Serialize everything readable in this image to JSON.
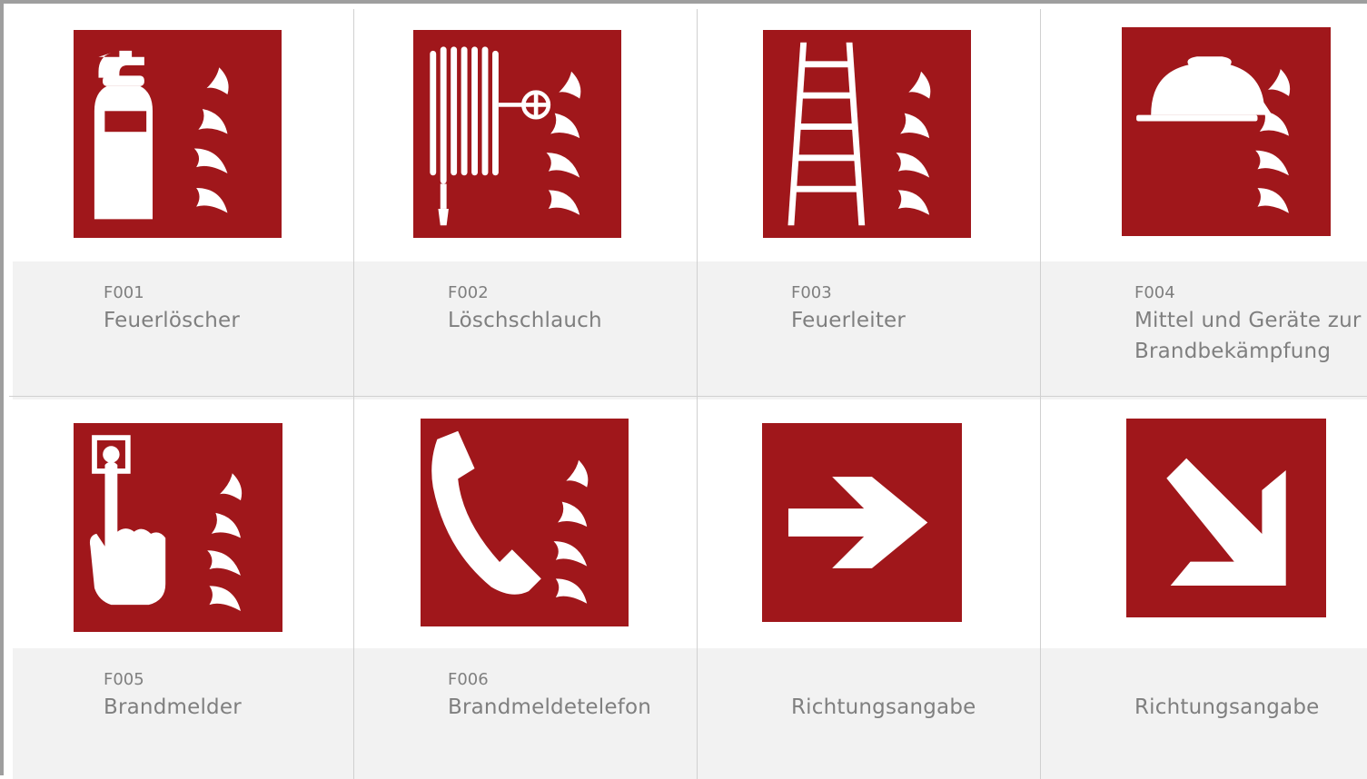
{
  "colors": {
    "sign_red": "#a0171b",
    "symbol": "#ffffff",
    "label_bg": "#f2f2f2",
    "label_text": "#7f7f7f",
    "frame": "#9e9e9e"
  },
  "signs": [
    {
      "code": "F001",
      "name": "Feuerlöscher",
      "icon": "fire-extinguisher-icon"
    },
    {
      "code": "F002",
      "name": "Löschschlauch",
      "icon": "fire-hose-icon"
    },
    {
      "code": "F003",
      "name": "Feuerleiter",
      "icon": "fire-ladder-icon"
    },
    {
      "code": "F004",
      "name": "Mittel und Geräte zur\nBrandbekämpfung",
      "icon": "firefighting-equipment-icon"
    },
    {
      "code": "F005",
      "name": "Brandmelder",
      "icon": "fire-alarm-call-point-icon"
    },
    {
      "code": "F006",
      "name": "Brandmeldetelefon",
      "icon": "fire-emergency-telephone-icon"
    },
    {
      "code": "",
      "name": "Richtungsangabe",
      "icon": "arrow-right-icon"
    },
    {
      "code": "",
      "name": "Richtungsangabe",
      "icon": "arrow-down-right-icon"
    }
  ]
}
